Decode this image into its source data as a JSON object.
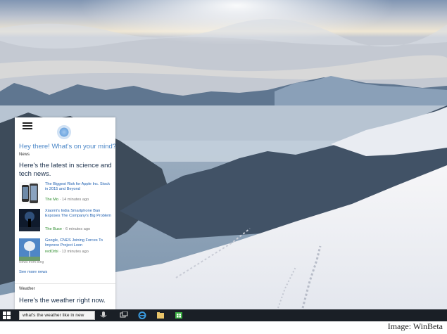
{
  "cortana": {
    "greeting": "Hey there! What's on your mind?",
    "news_label": "News",
    "news_headline": "Here's the latest in science and tech news.",
    "news_items": [
      {
        "title": "The Biggest Risk for Apple Inc. Stock in 2015 and Beyond",
        "source": "The Mo",
        "time": "14 minutes ago"
      },
      {
        "title": "Xiaomi's India Smartphone Ban Exposes The Company's Big Problem",
        "source": "The Buse",
        "time": "6 minutes ago"
      },
      {
        "title": "Google, CNES Joining Forces To Improve Project Loon",
        "source": "redOrbi",
        "time": "13 minutes ago"
      }
    ],
    "news_from_label": "News from Bing",
    "see_more": "See more news",
    "weather_label": "Weather",
    "weather_headline": "Here's the weather right now."
  },
  "taskbar": {
    "search_value": "what's the weather like in new",
    "icons": [
      "start-icon",
      "microphone-icon",
      "task-view-icon",
      "internet-explorer-icon",
      "file-explorer-icon",
      "store-icon"
    ]
  },
  "caption": "Image: WinBeta",
  "colors": {
    "accent": "#4a86c7",
    "link": "#1e5fb0",
    "taskbar": "#1a1f26",
    "source_green": "#2a8a2a"
  }
}
